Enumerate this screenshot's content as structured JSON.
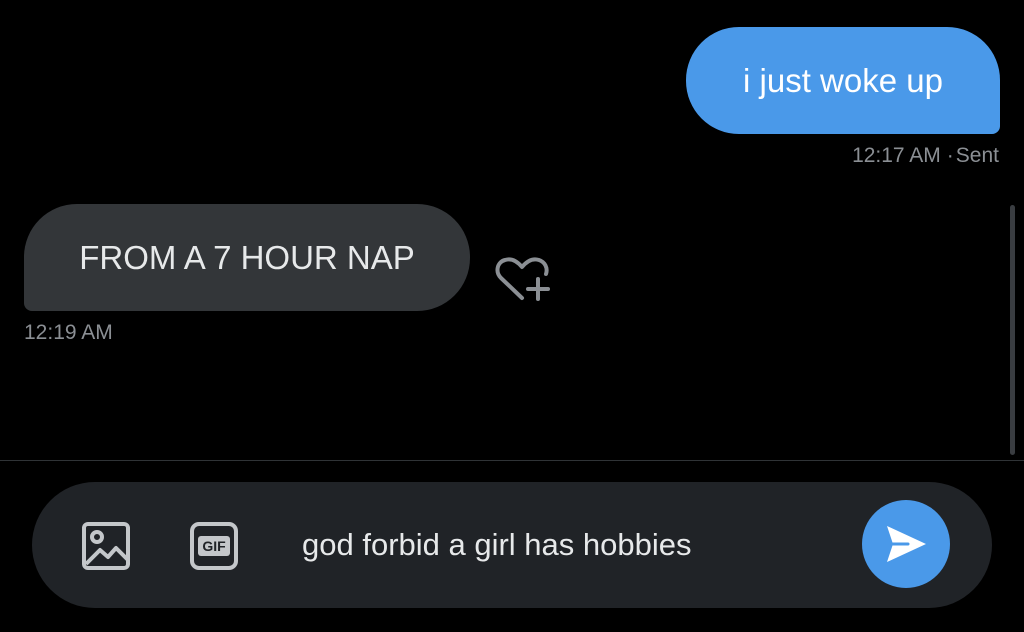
{
  "conversation": {
    "messages": [
      {
        "direction": "sent",
        "text": "i just woke up",
        "time": "12:17 AM",
        "status": "Sent"
      },
      {
        "direction": "received",
        "text": "FROM A 7 HOUR NAP",
        "time": "12:19 AM"
      }
    ],
    "meta_separator": "·"
  },
  "composer": {
    "message_value": "god forbid a girl has hobbies",
    "media_icon": "image-icon",
    "gif_icon": "gif-icon",
    "gif_label": "GIF",
    "send_icon": "send-icon",
    "react_icon": "heart-plus-icon"
  },
  "colors": {
    "background": "#000000",
    "sent_bubble": "#4a99e9",
    "received_bubble": "#333639",
    "composer_bg": "#202327",
    "accent": "#4a99e9",
    "meta_text": "#8b8f94"
  }
}
